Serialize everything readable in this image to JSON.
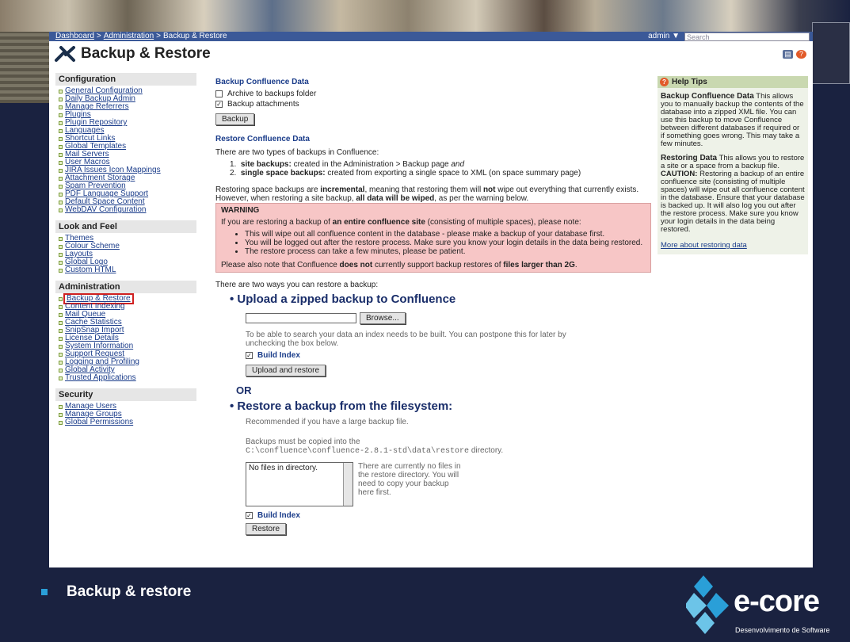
{
  "topnav": {
    "crumb1": "Dashboard",
    "sep1": ">",
    "crumb2": "Administration",
    "sep2": ">",
    "crumb3": "Backup & Restore",
    "user": "admin ▼",
    "search_placeholder": "Search"
  },
  "title": "Backup & Restore",
  "sidebar": {
    "configuration": {
      "label": "Configuration",
      "items": [
        "General Configuration",
        "Daily Backup Admin",
        "Manage Referrers",
        "Plugins",
        "Plugin Repository",
        "Languages",
        "Shortcut Links",
        "Global Templates",
        "Mail Servers",
        "User Macros",
        "JIRA Issues Icon Mappings",
        "Attachment Storage",
        "Spam Prevention",
        "PDF Language Support",
        "Default Space Content",
        "WebDAV Configuration"
      ]
    },
    "look": {
      "label": "Look and Feel",
      "items": [
        "Themes",
        "Colour Scheme",
        "Layouts",
        "Global Logo",
        "Custom HTML"
      ]
    },
    "administration": {
      "label": "Administration",
      "items": [
        "Backup & Restore",
        "Content Indexing",
        "Mail Queue",
        "Cache Statistics",
        "SnipSnap Import",
        "License Details",
        "System Information",
        "Support Request",
        "Logging and Profiling",
        "Global Activity",
        "Trusted Applications"
      ]
    },
    "security": {
      "label": "Security",
      "items": [
        "Manage Users",
        "Manage Groups",
        "Global Permissions"
      ]
    }
  },
  "backup": {
    "heading": "Backup Confluence Data",
    "archive_label": "Archive to backups folder",
    "attachments_label": "Backup attachments",
    "button": "Backup"
  },
  "restore": {
    "heading": "Restore Confluence Data",
    "intro": "There are two types of backups in Confluence:",
    "type1_bold": "site backups:",
    "type1_text": " created in the Administration > Backup page ",
    "type1_em": "and",
    "type2_bold": "single space backups:",
    "type2_text": " created from exporting a single space to XML (on space summary page)",
    "p1_a": "Restoring space backups are ",
    "p1_b": "incremental",
    "p1_c": ", meaning that restoring them will ",
    "p1_d": "not",
    "p1_e": " wipe out everything that currently exists. However, when restoring a site backup, ",
    "p1_f": "all data will be wiped",
    "p1_g": ", as per the warning below."
  },
  "warning": {
    "title": "WARNING",
    "intro_a": "If you are restoring a backup of ",
    "intro_b": "an entire confluence site",
    "intro_c": " (consisting of multiple spaces), please note:",
    "b1": "This will wipe out all confluence content in the database - please make a backup of your database first.",
    "b2": "You will be logged out after the restore process. Make sure you know your login details in the data being restored.",
    "b3": "The restore process can take a few minutes, please be patient.",
    "note_a": "Please also note that Confluence ",
    "note_b": "does not",
    "note_c": " currently support backup restores of ",
    "note_d": "files larger than 2G",
    "note_e": "."
  },
  "ways": "There are two ways you can restore a backup:",
  "upload": {
    "heading": "Upload a zipped backup to Confluence",
    "browse": "Browse...",
    "hint": "To be able to search your data an index needs to be built. You can postpone this for later by unchecking the box below.",
    "build_index": "Build Index",
    "button": "Upload and restore"
  },
  "or": "OR",
  "fs": {
    "heading": "Restore a backup from the filesystem:",
    "recommend": "Recommended if you have a large backup file.",
    "copy_a": "Backups must be copied into the",
    "path": "C:\\confluence\\confluence-2.8.1-std\\data\\restore",
    "copy_b": " directory.",
    "list_value": "No files in directory.",
    "note": "There are currently no files in the restore directory. You will need to copy your backup here first.",
    "build_index": "Build Index",
    "button": "Restore"
  },
  "help": {
    "title": "Help Tips",
    "b1": "Backup Confluence Data",
    "t1": " This allows you to manually backup the contents of the database into a zipped XML file. You can use this backup to move Confluence between different databases if required or if something goes wrong. This may take a few minutes.",
    "b2": "Restoring Data",
    "t2": " This allows you to restore a site or a space from a backup file. ",
    "b3": "CAUTION:",
    "t3": " Restoring a backup of an entire confluence site (consisting of multiple spaces) will wipe out all confluence content in the database. Ensure that your database is backed up. It will also log you out after the restore process. Make sure you know your login details in the data being restored.",
    "link": "More about restoring data"
  },
  "caption": "Backup & restore",
  "logo": {
    "text": "e-core",
    "sub": "Desenvolvimento de Software"
  },
  "colors": {
    "nav": "#3b5998",
    "link": "#1a3c8a",
    "warning_bg": "#f7c6c6",
    "help_bg": "#eef2e8",
    "slide_bg": "#1a2240"
  }
}
